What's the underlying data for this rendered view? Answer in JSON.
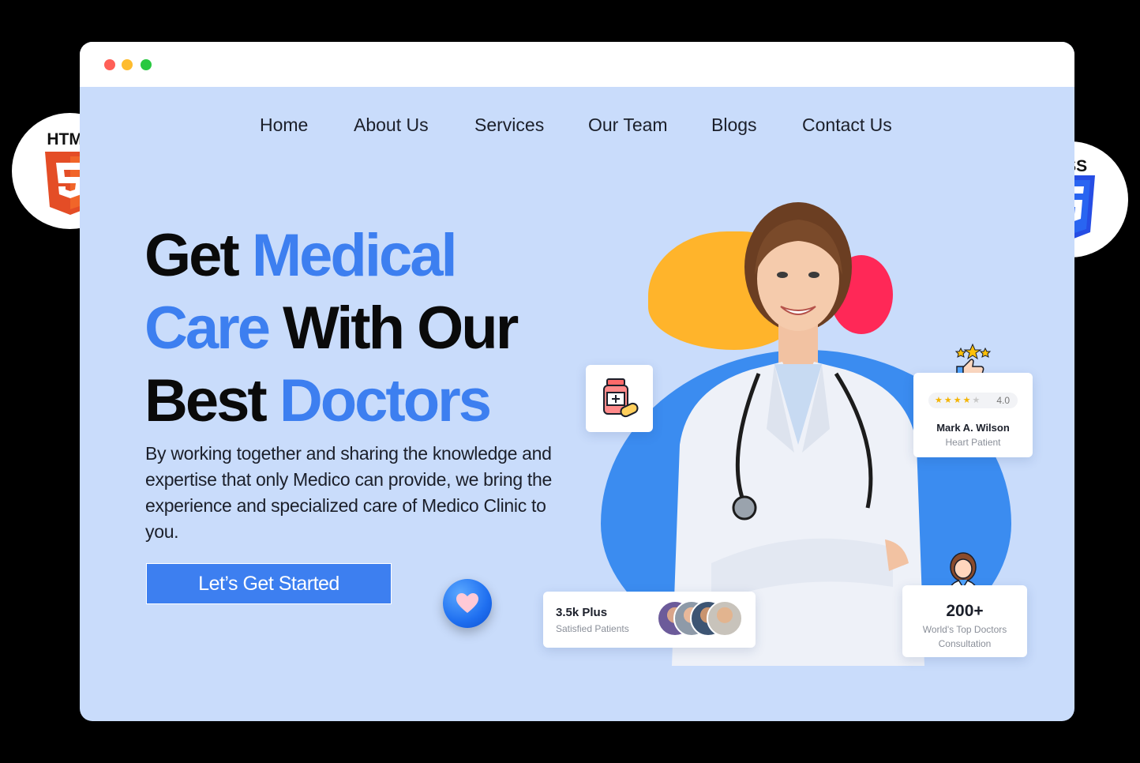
{
  "window": {
    "dots": [
      "close",
      "minimize",
      "maximize"
    ]
  },
  "nav": {
    "items": [
      {
        "label": "Home"
      },
      {
        "label": "About Us"
      },
      {
        "label": "Services"
      },
      {
        "label": "Our Team"
      },
      {
        "label": "Blogs"
      },
      {
        "label": "Contact Us"
      }
    ]
  },
  "hero": {
    "title_line1_a": "Get",
    "title_line1_b": "Medical",
    "title_line2_a": "Care",
    "title_line2_b": "With Our",
    "title_line3_a": "Best",
    "title_line3_b": "Doctors",
    "description": "By working together and sharing the knowledge and expertise that only Medico can provide, we bring the experience and specialized care of Medico Clinic to you.",
    "cta_label": "Let’s Get Started"
  },
  "review": {
    "rating": "4.0",
    "stars_filled": 4,
    "stars_total": 5,
    "name": "Mark A. Wilson",
    "subtitle": "Heart Patient"
  },
  "patients": {
    "title": "3.5k Plus",
    "subtitle": "Satisfied Patients"
  },
  "doctors": {
    "count": "200+",
    "subtitle_line1": "World's Top Doctors",
    "subtitle_line2": "Consultation"
  },
  "badges": {
    "html_label": "HTML",
    "css_label": "CSS"
  },
  "colors": {
    "accent": "#3d7ff0",
    "page_bg": "#c9dcfb",
    "blob_yellow": "#ffb42b",
    "blob_red": "#ff2857",
    "html_orange": "#e44d26",
    "css_blue": "#264de4"
  }
}
